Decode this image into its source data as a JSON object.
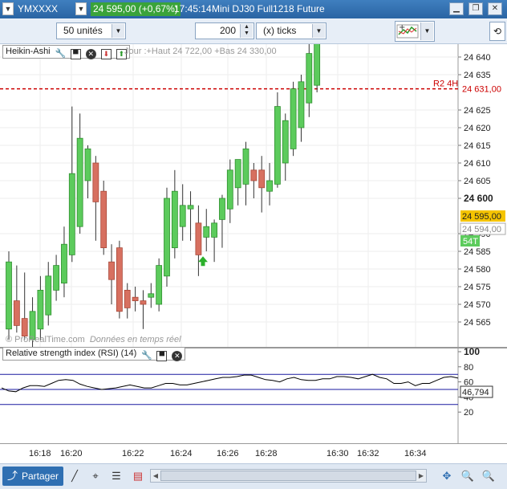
{
  "titlebar": {
    "symbol": "YMXXXX",
    "price_change": "24 595,00 (+0,67%)",
    "time": "17:45:14",
    "instrument": "Mini DJ30 Full1218 Future"
  },
  "toolbar": {
    "units_select": "50 unités",
    "ticks_value": "200",
    "ticks_label": "(x) ticks"
  },
  "price_panel": {
    "indicator_name": "Heikin-Ashi",
    "day_info": "Jour :+Haut 24 722,00 +Bas 24 330,00",
    "watermark": "© ProRealTime.com",
    "watermark_suffix": "Données en temps réel",
    "y_ticks": [
      "24 640",
      "24 635",
      "24 625",
      "24 620",
      "24 615",
      "24 610",
      "24 605",
      "24 600",
      "24 590",
      "24 585",
      "24 580",
      "24 575",
      "24 570",
      "24 565"
    ],
    "r2_label": "R2 4H",
    "r2_value": "24 631,00",
    "last_price": "24 595,00",
    "grey_price": "24 594,00",
    "countdown": "54T"
  },
  "rsi_panel": {
    "title": "Relative strength index (RSI) (14)",
    "y_ticks": [
      "100",
      "80",
      "60",
      "40",
      "20"
    ],
    "value": "46,794"
  },
  "x_axis": {
    "labels": [
      "16:18",
      "16:20",
      "16:22",
      "16:24",
      "16:26",
      "16:28",
      "16:30",
      "16:32",
      "16:34"
    ]
  },
  "bottom": {
    "share_label": "Partager"
  },
  "colors": {
    "up_candle": "#5ccb5c",
    "down_candle": "#d77060",
    "r2_line": "#cc0000",
    "rsi_line": "#000000",
    "rsi_bands": "#1a1aa0",
    "price_badge": "#3aa33a"
  },
  "chart_data": {
    "type": "candlestick",
    "title": "Heikin-Ashi",
    "price_levels": {
      "r2_4h": 24631,
      "last": 24595,
      "previous": 24594
    },
    "candles": [
      {
        "o": 24563,
        "h": 24585,
        "l": 24560,
        "c": 24582,
        "dir": "up"
      },
      {
        "o": 24571,
        "h": 24581,
        "l": 24562,
        "c": 24564,
        "dir": "down"
      },
      {
        "o": 24566,
        "h": 24579,
        "l": 24560,
        "c": 24561,
        "dir": "down"
      },
      {
        "o": 24560,
        "h": 24572,
        "l": 24555,
        "c": 24568,
        "dir": "up"
      },
      {
        "o": 24563,
        "h": 24578,
        "l": 24560,
        "c": 24574,
        "dir": "up"
      },
      {
        "o": 24567,
        "h": 24582,
        "l": 24564,
        "c": 24578,
        "dir": "up"
      },
      {
        "o": 24574,
        "h": 24584,
        "l": 24571,
        "c": 24581,
        "dir": "up"
      },
      {
        "o": 24576,
        "h": 24592,
        "l": 24572,
        "c": 24587,
        "dir": "up"
      },
      {
        "o": 24584,
        "h": 24626,
        "l": 24582,
        "c": 24607,
        "dir": "up"
      },
      {
        "o": 24592,
        "h": 24624,
        "l": 24590,
        "c": 24617,
        "dir": "up"
      },
      {
        "o": 24605,
        "h": 24615,
        "l": 24600,
        "c": 24614,
        "dir": "up"
      },
      {
        "o": 24610,
        "h": 24612,
        "l": 24588,
        "c": 24599,
        "dir": "down"
      },
      {
        "o": 24602,
        "h": 24605,
        "l": 24584,
        "c": 24586,
        "dir": "down"
      },
      {
        "o": 24582,
        "h": 24587,
        "l": 24570,
        "c": 24577,
        "dir": "down"
      },
      {
        "o": 24586,
        "h": 24588,
        "l": 24566,
        "c": 24568,
        "dir": "down"
      },
      {
        "o": 24574,
        "h": 24576,
        "l": 24566,
        "c": 24569,
        "dir": "down"
      },
      {
        "o": 24572,
        "h": 24575,
        "l": 24568,
        "c": 24571,
        "dir": "down"
      },
      {
        "o": 24570,
        "h": 24574,
        "l": 24563,
        "c": 24571,
        "dir": "down"
      },
      {
        "o": 24572,
        "h": 24576,
        "l": 24569,
        "c": 24573,
        "dir": "up"
      },
      {
        "o": 24570,
        "h": 24583,
        "l": 24568,
        "c": 24581,
        "dir": "up"
      },
      {
        "o": 24578,
        "h": 24603,
        "l": 24575,
        "c": 24600,
        "dir": "up"
      },
      {
        "o": 24586,
        "h": 24608,
        "l": 24583,
        "c": 24602,
        "dir": "up"
      },
      {
        "o": 24592,
        "h": 24604,
        "l": 24588,
        "c": 24598,
        "dir": "up"
      },
      {
        "o": 24597,
        "h": 24602,
        "l": 24588,
        "c": 24598,
        "dir": "up"
      },
      {
        "o": 24593,
        "h": 24598,
        "l": 24578,
        "c": 24584,
        "dir": "down"
      },
      {
        "o": 24589,
        "h": 24597,
        "l": 24585,
        "c": 24592,
        "dir": "up"
      },
      {
        "o": 24589,
        "h": 24594,
        "l": 24582,
        "c": 24593,
        "dir": "up"
      },
      {
        "o": 24594,
        "h": 24601,
        "l": 24586,
        "c": 24600,
        "dir": "up"
      },
      {
        "o": 24597,
        "h": 24611,
        "l": 24593,
        "c": 24608,
        "dir": "up"
      },
      {
        "o": 24603,
        "h": 24609,
        "l": 24598,
        "c": 24611,
        "dir": "up"
      },
      {
        "o": 24604,
        "h": 24616,
        "l": 24598,
        "c": 24614,
        "dir": "up"
      },
      {
        "o": 24608,
        "h": 24610,
        "l": 24600,
        "c": 24605,
        "dir": "down"
      },
      {
        "o": 24603,
        "h": 24612,
        "l": 24596,
        "c": 24608,
        "dir": "down"
      },
      {
        "o": 24602,
        "h": 24610,
        "l": 24598,
        "c": 24605,
        "dir": "up"
      },
      {
        "o": 24604,
        "h": 24630,
        "l": 24603,
        "c": 24626,
        "dir": "up"
      },
      {
        "o": 24610,
        "h": 24624,
        "l": 24605,
        "c": 24622,
        "dir": "up"
      },
      {
        "o": 24614,
        "h": 24633,
        "l": 24612,
        "c": 24631,
        "dir": "up"
      },
      {
        "o": 24620,
        "h": 24635,
        "l": 24616,
        "c": 24633,
        "dir": "up"
      },
      {
        "o": 24627,
        "h": 24645,
        "l": 24623,
        "c": 24641,
        "dir": "up"
      },
      {
        "o": 24632,
        "h": 24650,
        "l": 24630,
        "c": 24648,
        "dir": "up"
      }
    ],
    "rsi": [
      52,
      48,
      47,
      52,
      55,
      55,
      54,
      58,
      62,
      63,
      62,
      57,
      54,
      52,
      50,
      51,
      52,
      54,
      56,
      54,
      52,
      52,
      55,
      58,
      58,
      56,
      56,
      58,
      60,
      62,
      64,
      66,
      66,
      67,
      69,
      69,
      66,
      63,
      62,
      60,
      64,
      66,
      63,
      62,
      62,
      64,
      64,
      67,
      67,
      66,
      64,
      67,
      70,
      66,
      64,
      58,
      58,
      60,
      55,
      58,
      58,
      62,
      66,
      67,
      65
    ],
    "rsi_levels": [
      70,
      50,
      30
    ]
  }
}
